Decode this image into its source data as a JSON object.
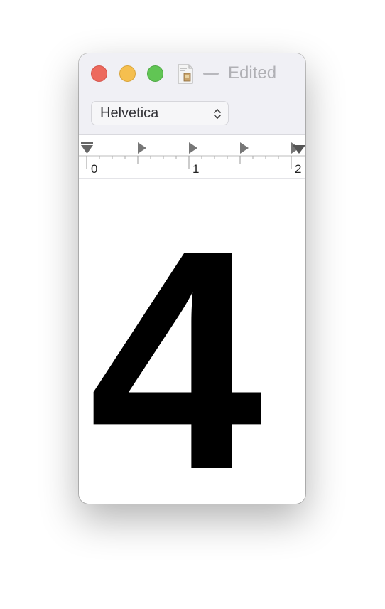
{
  "window": {
    "title": "Edited",
    "controls": {
      "close": "close-window",
      "minimize": "minimize-window",
      "zoom": "zoom-window"
    }
  },
  "toolbar": {
    "font_family": "Helvetica"
  },
  "ruler": {
    "labels": [
      "0",
      "1",
      "2"
    ]
  },
  "document": {
    "text": "4"
  },
  "colors": {
    "close": "#ed6a5e",
    "minimize": "#f5bf4f",
    "zoom": "#61c554",
    "titlebar": "#f0f0f5"
  }
}
